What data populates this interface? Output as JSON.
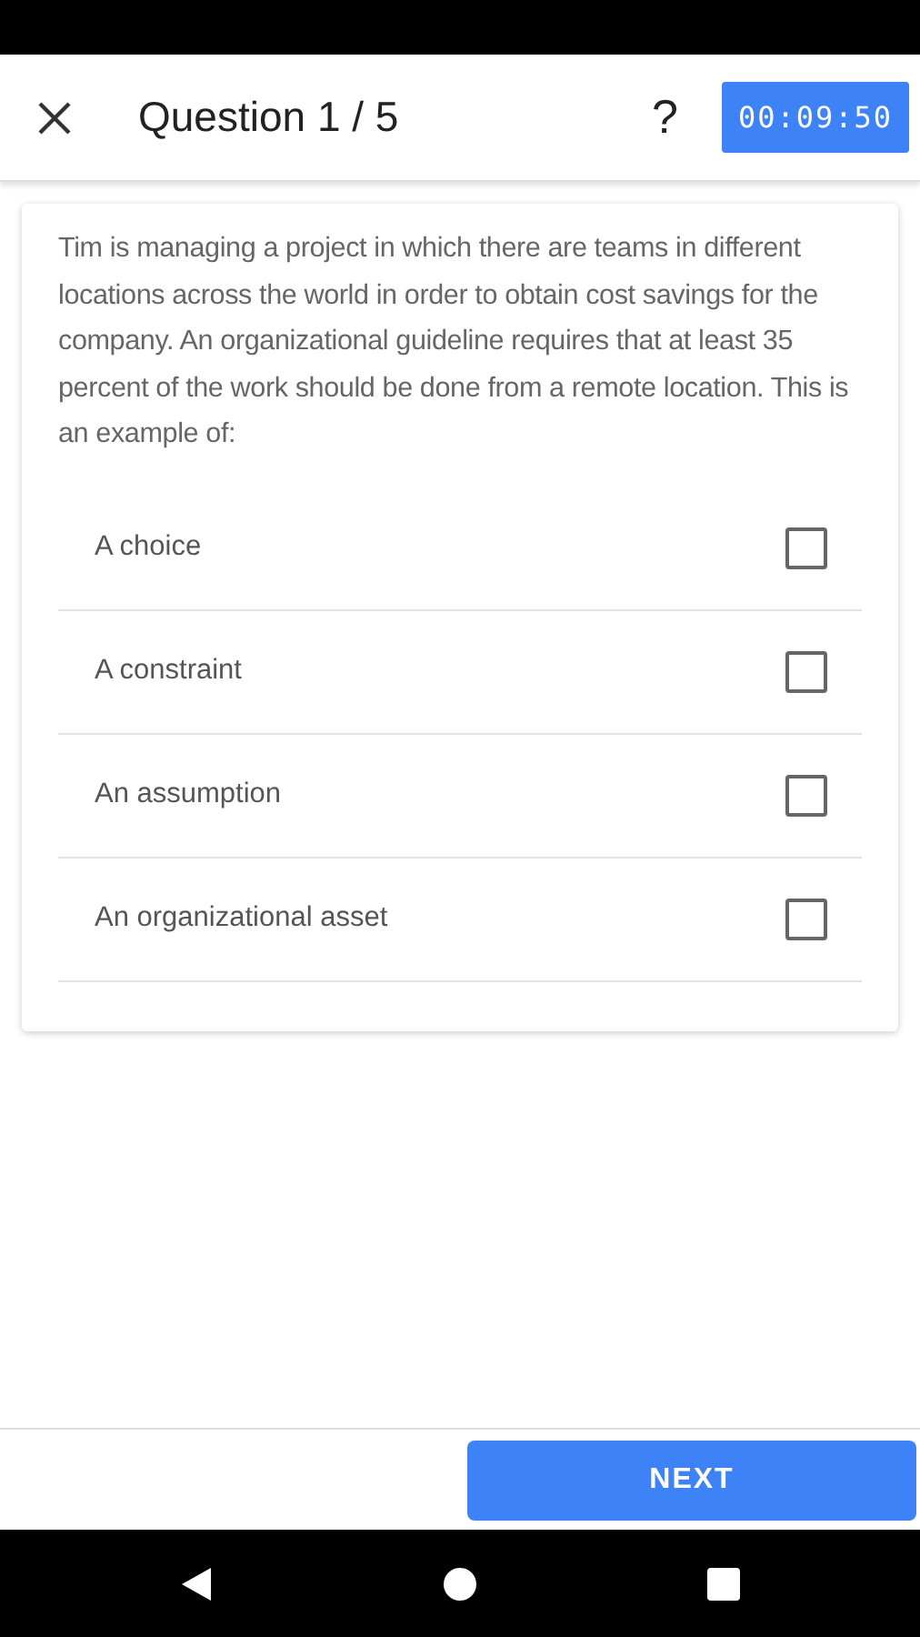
{
  "header": {
    "title": "Question 1 / 5",
    "help": "?",
    "timer": "00:09:50"
  },
  "question": {
    "text": "Tim is managing a project in which there are teams in different locations across the world in order to obtain cost savings for the company. An organizational guideline requires that at least 35 percent of the work should be done from a remote location. This is an example of:",
    "options": [
      {
        "label": "A choice",
        "checked": false
      },
      {
        "label": "A constraint",
        "checked": false
      },
      {
        "label": "An assumption",
        "checked": false
      },
      {
        "label": "An organizational asset",
        "checked": false
      }
    ]
  },
  "footer": {
    "next": "NEXT"
  }
}
